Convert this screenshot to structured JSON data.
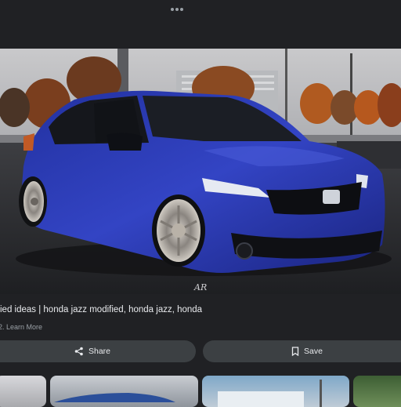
{
  "header": {
    "menu_icon": "more-horizontal-icon"
  },
  "result": {
    "caption": "ied ideas | honda jazz modified, honda jazz, honda",
    "source_prefix": "2.",
    "learn_more": "Learn More",
    "watermark": "AR"
  },
  "actions": {
    "share_label": "Share",
    "share_icon": "share-icon",
    "save_label": "Save",
    "save_icon": "bookmark-icon"
  },
  "colors": {
    "background": "#202124",
    "button": "#3c4043",
    "car_blue": "#2a39a8"
  }
}
